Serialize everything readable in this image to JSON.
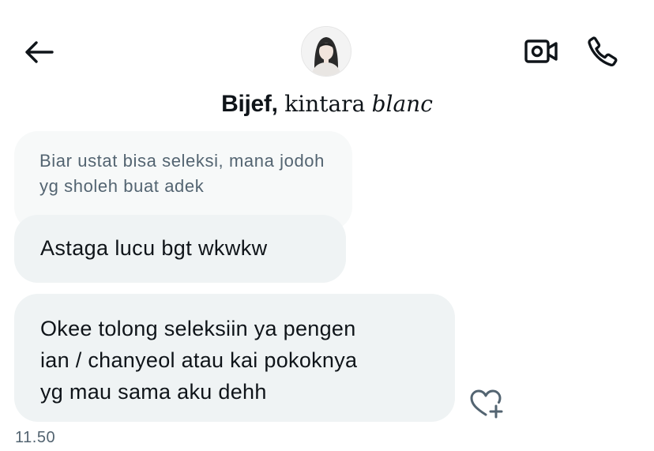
{
  "header": {
    "title_bold": "Bijef",
    "title_sep": ",",
    "title_rest": "kintara",
    "title_italic": "blanc"
  },
  "icons": {
    "back": "back-arrow-icon",
    "video": "video-call-icon",
    "call": "phone-icon",
    "react": "add-reaction-heart-icon"
  },
  "quoted_message": {
    "text": "Biar ustat bisa seleksi, mana jodoh yg sholeh buat adek"
  },
  "messages": [
    {
      "lines": [
        "Astaga lucu bgt wkwkw"
      ]
    },
    {
      "lines": [
        "Okee tolong seleksiin ya pengen",
        "ian / chanyeol atau kai pokoknya",
        "yg mau sama aku dehh"
      ]
    }
  ],
  "timestamp": "11.50",
  "colors": {
    "bubble": "#eff3f4",
    "quoted_bubble": "#f7f9f9",
    "muted_text": "#536471",
    "text": "#0f1419"
  }
}
